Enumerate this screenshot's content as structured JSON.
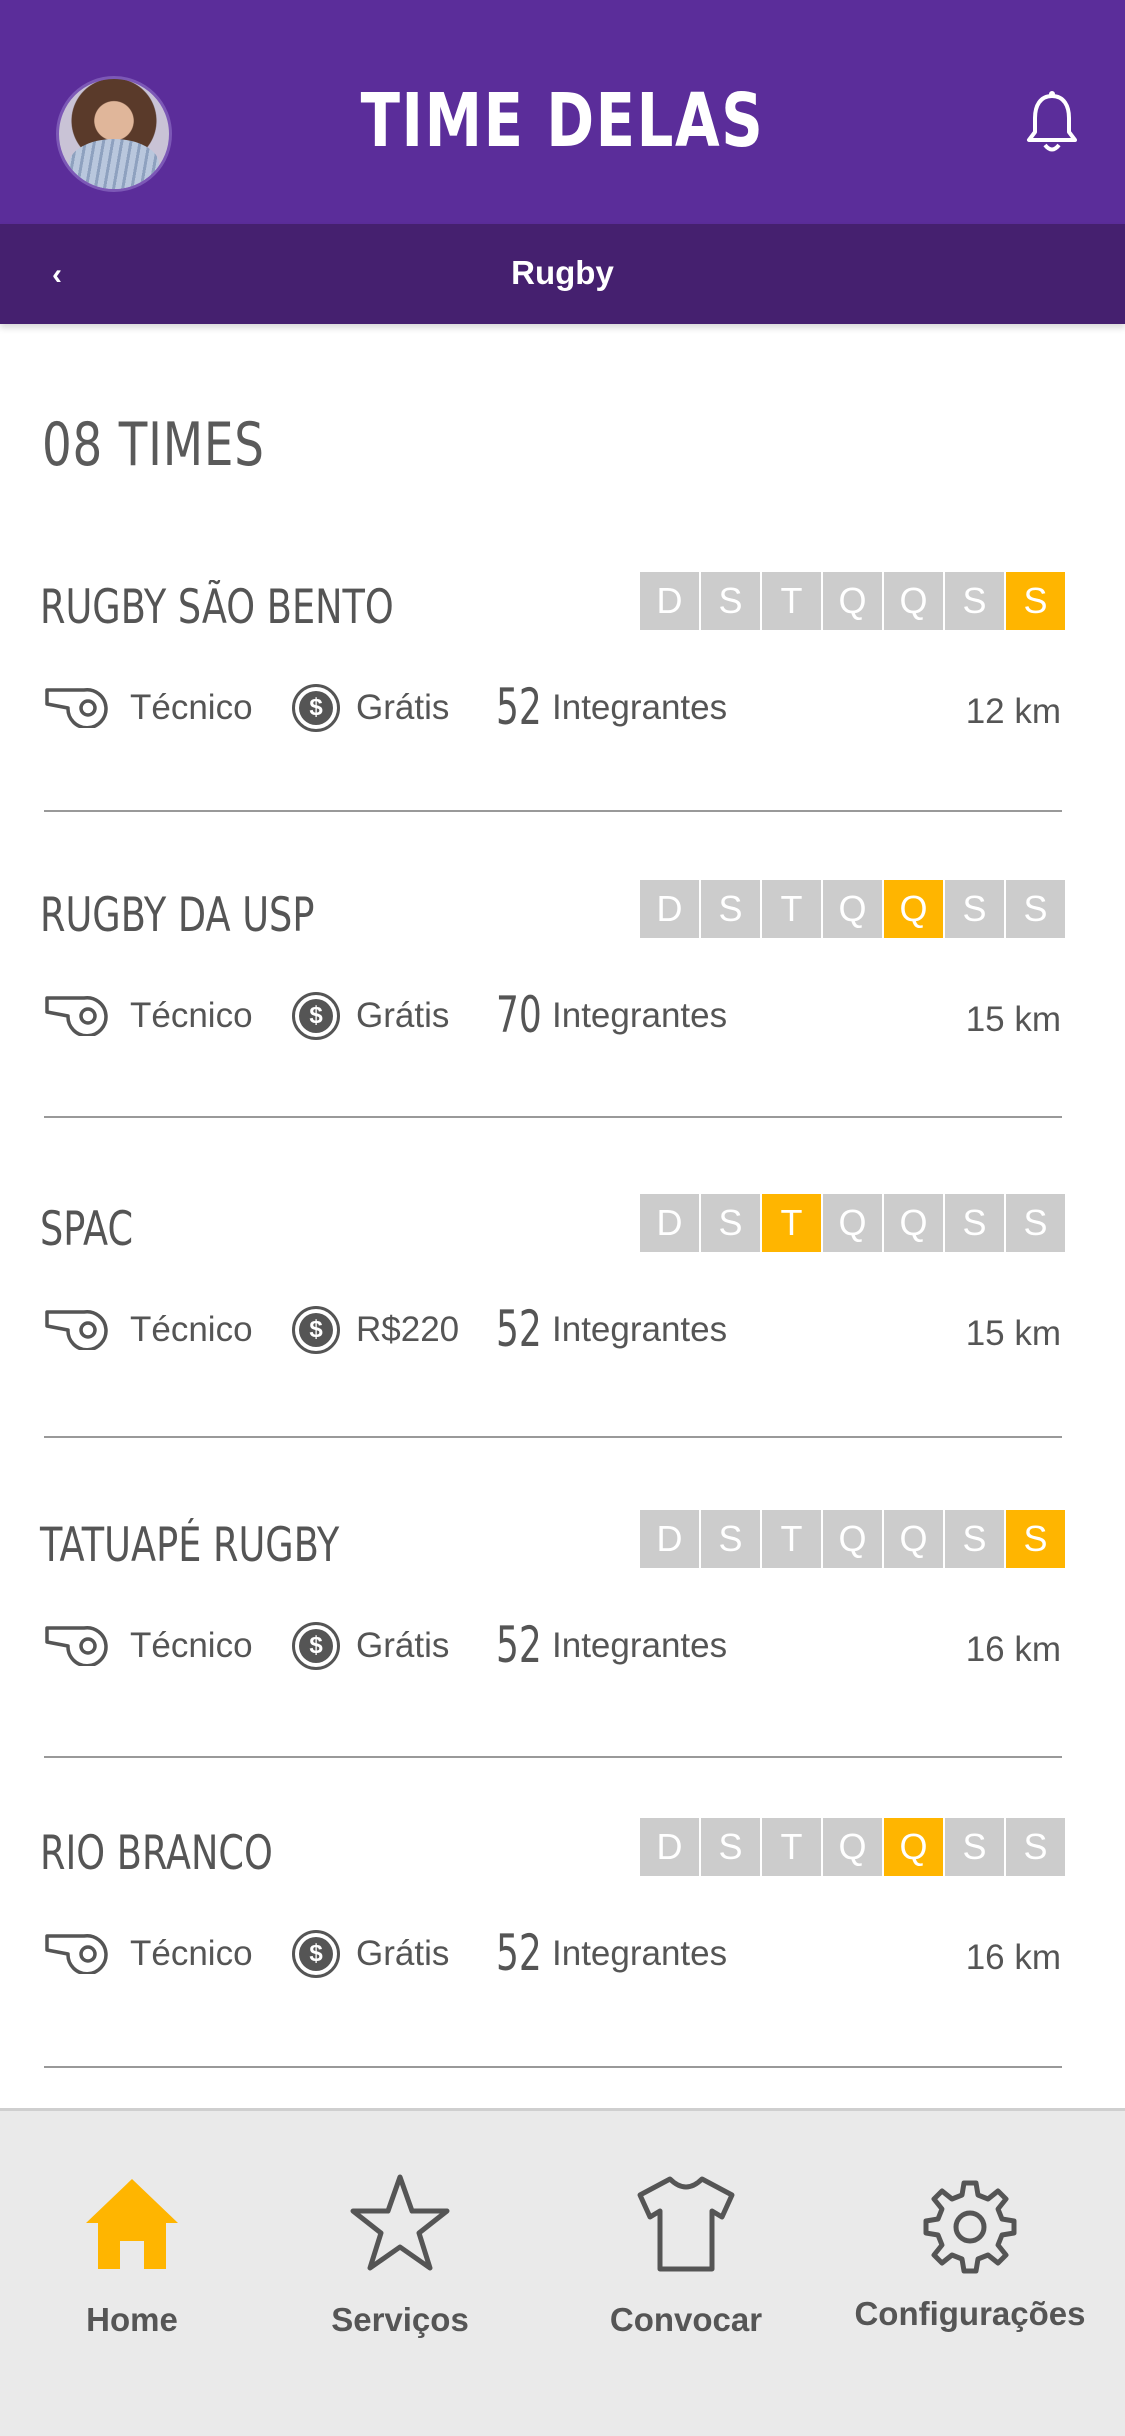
{
  "header": {
    "app_title": "TIME DELAS",
    "avatar_icon": "user-avatar",
    "bell_icon": "bell-icon",
    "back_label": "‹",
    "sport": "Rugby"
  },
  "colors": {
    "header_bg": "#5b2d9a",
    "subbar_bg": "#45206f",
    "accent": "#ffb500",
    "day_inactive": "#cccccc",
    "text": "#555555"
  },
  "content": {
    "count_title": "08 TIMES",
    "day_letters": [
      "D",
      "S",
      "T",
      "Q",
      "Q",
      "S",
      "S"
    ],
    "teams": [
      {
        "name": "RUGBY SÃO BENTO",
        "active_day": 6,
        "coach": "Técnico",
        "price": "Grátis",
        "members": "52",
        "members_label": "Integrantes",
        "distance": "12 km"
      },
      {
        "name": "RUGBY DA USP",
        "active_day": 4,
        "coach": "Técnico",
        "price": "Grátis",
        "members": "70",
        "members_label": "Integrantes",
        "distance": "15 km"
      },
      {
        "name": "SPAC",
        "active_day": 2,
        "coach": "Técnico",
        "price": "R$220",
        "members": "52",
        "members_label": "Integrantes",
        "distance": "15 km"
      },
      {
        "name": "TATUAPÉ RUGBY",
        "active_day": 6,
        "coach": "Técnico",
        "price": "Grátis",
        "members": "52",
        "members_label": "Integrantes",
        "distance": "16 km"
      },
      {
        "name": "RIO BRANCO",
        "active_day": 4,
        "coach": "Técnico",
        "price": "Grátis",
        "members": "52",
        "members_label": "Integrantes",
        "distance": "16 km"
      }
    ]
  },
  "tabbar": {
    "tabs": [
      {
        "label": "Home",
        "icon": "home-icon",
        "active": true
      },
      {
        "label": "Serviços",
        "icon": "star-icon",
        "active": false
      },
      {
        "label": "Convocar",
        "icon": "shirt-icon",
        "active": false
      },
      {
        "label": "Configurações",
        "icon": "gear-icon",
        "active": false
      }
    ]
  }
}
